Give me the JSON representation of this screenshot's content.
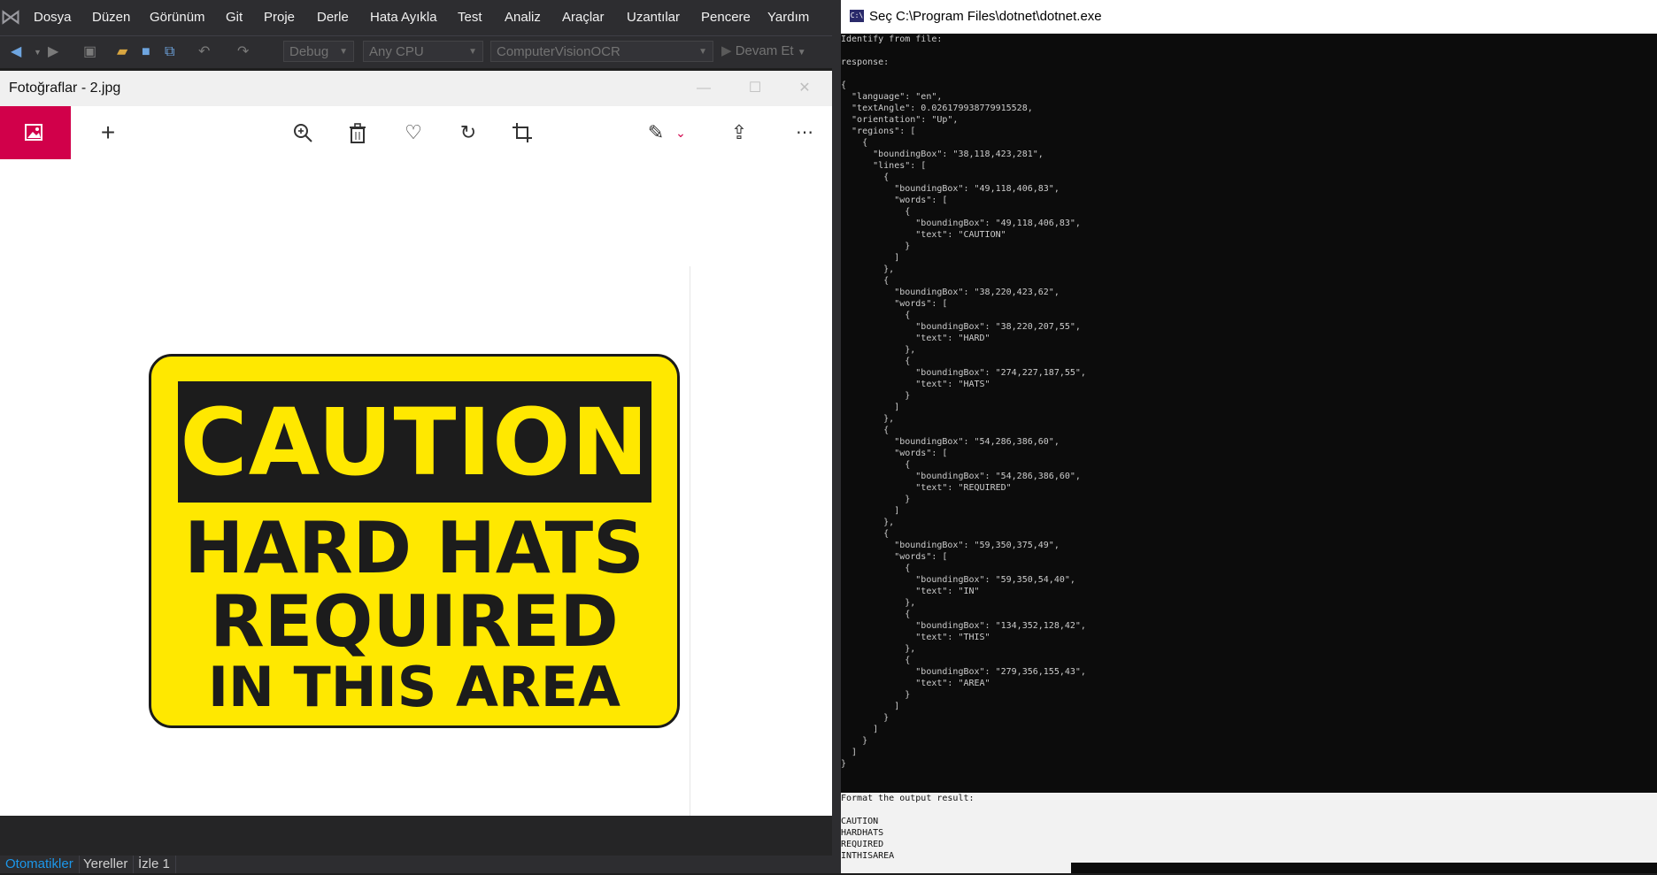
{
  "vs": {
    "menu": [
      "Dosya",
      "Düzen",
      "Görünüm",
      "Git",
      "Proje",
      "Derle",
      "Hata Ayıkla",
      "Test",
      "Analiz",
      "Araçlar",
      "Uzantılar",
      "Pencere",
      "Yardım"
    ],
    "toolbar": {
      "config": "Debug",
      "platform": "Any CPU",
      "project": "ComputerVisionOCR",
      "continue": "Devam Et"
    },
    "bottom_tabs": [
      "Otomatikler",
      "Yereller",
      "İzle 1"
    ]
  },
  "photos": {
    "title": "Fotoğraflar - 2.jpg",
    "icons": [
      "gallery-icon",
      "add-icon",
      "zoom-in-icon",
      "delete-icon",
      "favorite-icon",
      "rotate-icon",
      "crop-icon",
      "edit-draw-icon",
      "share-icon",
      "more-icon",
      "expand-icon"
    ],
    "sign": {
      "line_caution": "CAUTION",
      "line_1": "HARD HATS",
      "line_2": "REQUIRED",
      "line_3": "IN THIS AREA"
    }
  },
  "console": {
    "title": "Seç C:\\Program Files\\dotnet\\dotnet.exe",
    "output": "Identify from file:\n\nresponse:\n\n{\n  \"language\": \"en\",\n  \"textAngle\": 0.026179938779915528,\n  \"orientation\": \"Up\",\n  \"regions\": [\n    {\n      \"boundingBox\": \"38,118,423,281\",\n      \"lines\": [\n        {\n          \"boundingBox\": \"49,118,406,83\",\n          \"words\": [\n            {\n              \"boundingBox\": \"49,118,406,83\",\n              \"text\": \"CAUTION\"\n            }\n          ]\n        },\n        {\n          \"boundingBox\": \"38,220,423,62\",\n          \"words\": [\n            {\n              \"boundingBox\": \"38,220,207,55\",\n              \"text\": \"HARD\"\n            },\n            {\n              \"boundingBox\": \"274,227,187,55\",\n              \"text\": \"HATS\"\n            }\n          ]\n        },\n        {\n          \"boundingBox\": \"54,286,386,60\",\n          \"words\": [\n            {\n              \"boundingBox\": \"54,286,386,60\",\n              \"text\": \"REQUIRED\"\n            }\n          ]\n        },\n        {\n          \"boundingBox\": \"59,350,375,49\",\n          \"words\": [\n            {\n              \"boundingBox\": \"59,350,54,40\",\n              \"text\": \"IN\"\n            },\n            {\n              \"boundingBox\": \"134,352,128,42\",\n              \"text\": \"THIS\"\n            },\n            {\n              \"boundingBox\": \"279,356,155,43\",\n              \"text\": \"AREA\"\n            }\n          ]\n        }\n      ]\n    }\n  ]\n}",
    "format_output": "Format the output result:\n\nCAUTION\nHARDHATS\nREQUIRED\nINTHISAREA"
  }
}
